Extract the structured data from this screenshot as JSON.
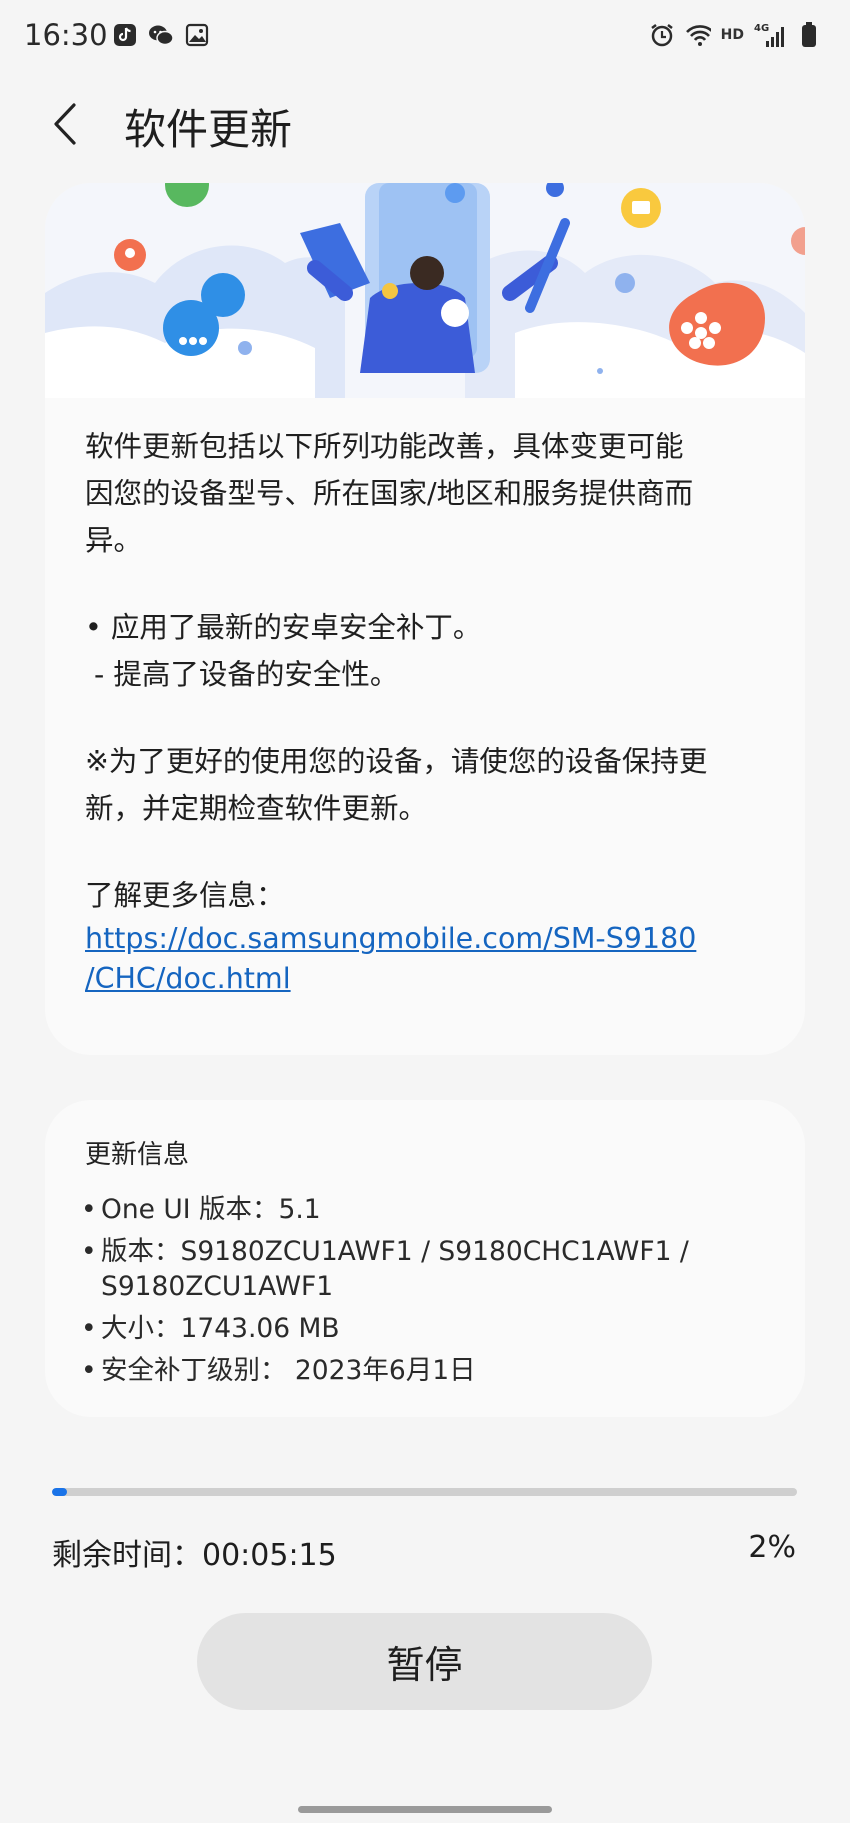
{
  "status_bar": {
    "time": "16:30",
    "hd_label": "HD",
    "network_label": "4G",
    "left_icons": [
      "tiktok-icon",
      "wechat-icon",
      "gallery-icon"
    ],
    "right_icons": [
      "alarm-icon",
      "wifi-icon",
      "signal-icon",
      "battery-icon"
    ]
  },
  "header": {
    "title": "软件更新"
  },
  "release_notes": {
    "intro_line1": "软件更新包括以下所列功能改善，具体变更可能",
    "intro_line2": "因您的设备型号、所在国家/地区和服务提供商而",
    "intro_line3": "异。",
    "bullet": "• 应用了最新的安卓安全补丁。",
    "sub_bullet": " - 提高了设备的安全性。",
    "note_line1": "※为了更好的使用您的设备，请使您的设备保持更",
    "note_line2": "新，并定期检查软件更新。",
    "more_info_label": "了解更多信息：",
    "link_line1": "https://doc.samsungmobile.com/SM-S9180",
    "link_line2": "/CHC/doc.html"
  },
  "update_info": {
    "title": "更新信息",
    "items": [
      "One UI 版本：5.1",
      "版本：S9180ZCU1AWF1 / S9180CHC1AWF1 / S9180ZCU1AWF1",
      "大小：1743.06 MB",
      "安全补丁级别： 2023年6月1日"
    ]
  },
  "download": {
    "progress_fraction": 0.02,
    "remaining_label": "剩余时间：00:05:15",
    "percent_label": "2%",
    "pause_label": "暂停"
  },
  "colors": {
    "accent": "#1a73e8",
    "link": "#1565c0",
    "background": "#f5f5f5",
    "card": "#fafafa"
  }
}
